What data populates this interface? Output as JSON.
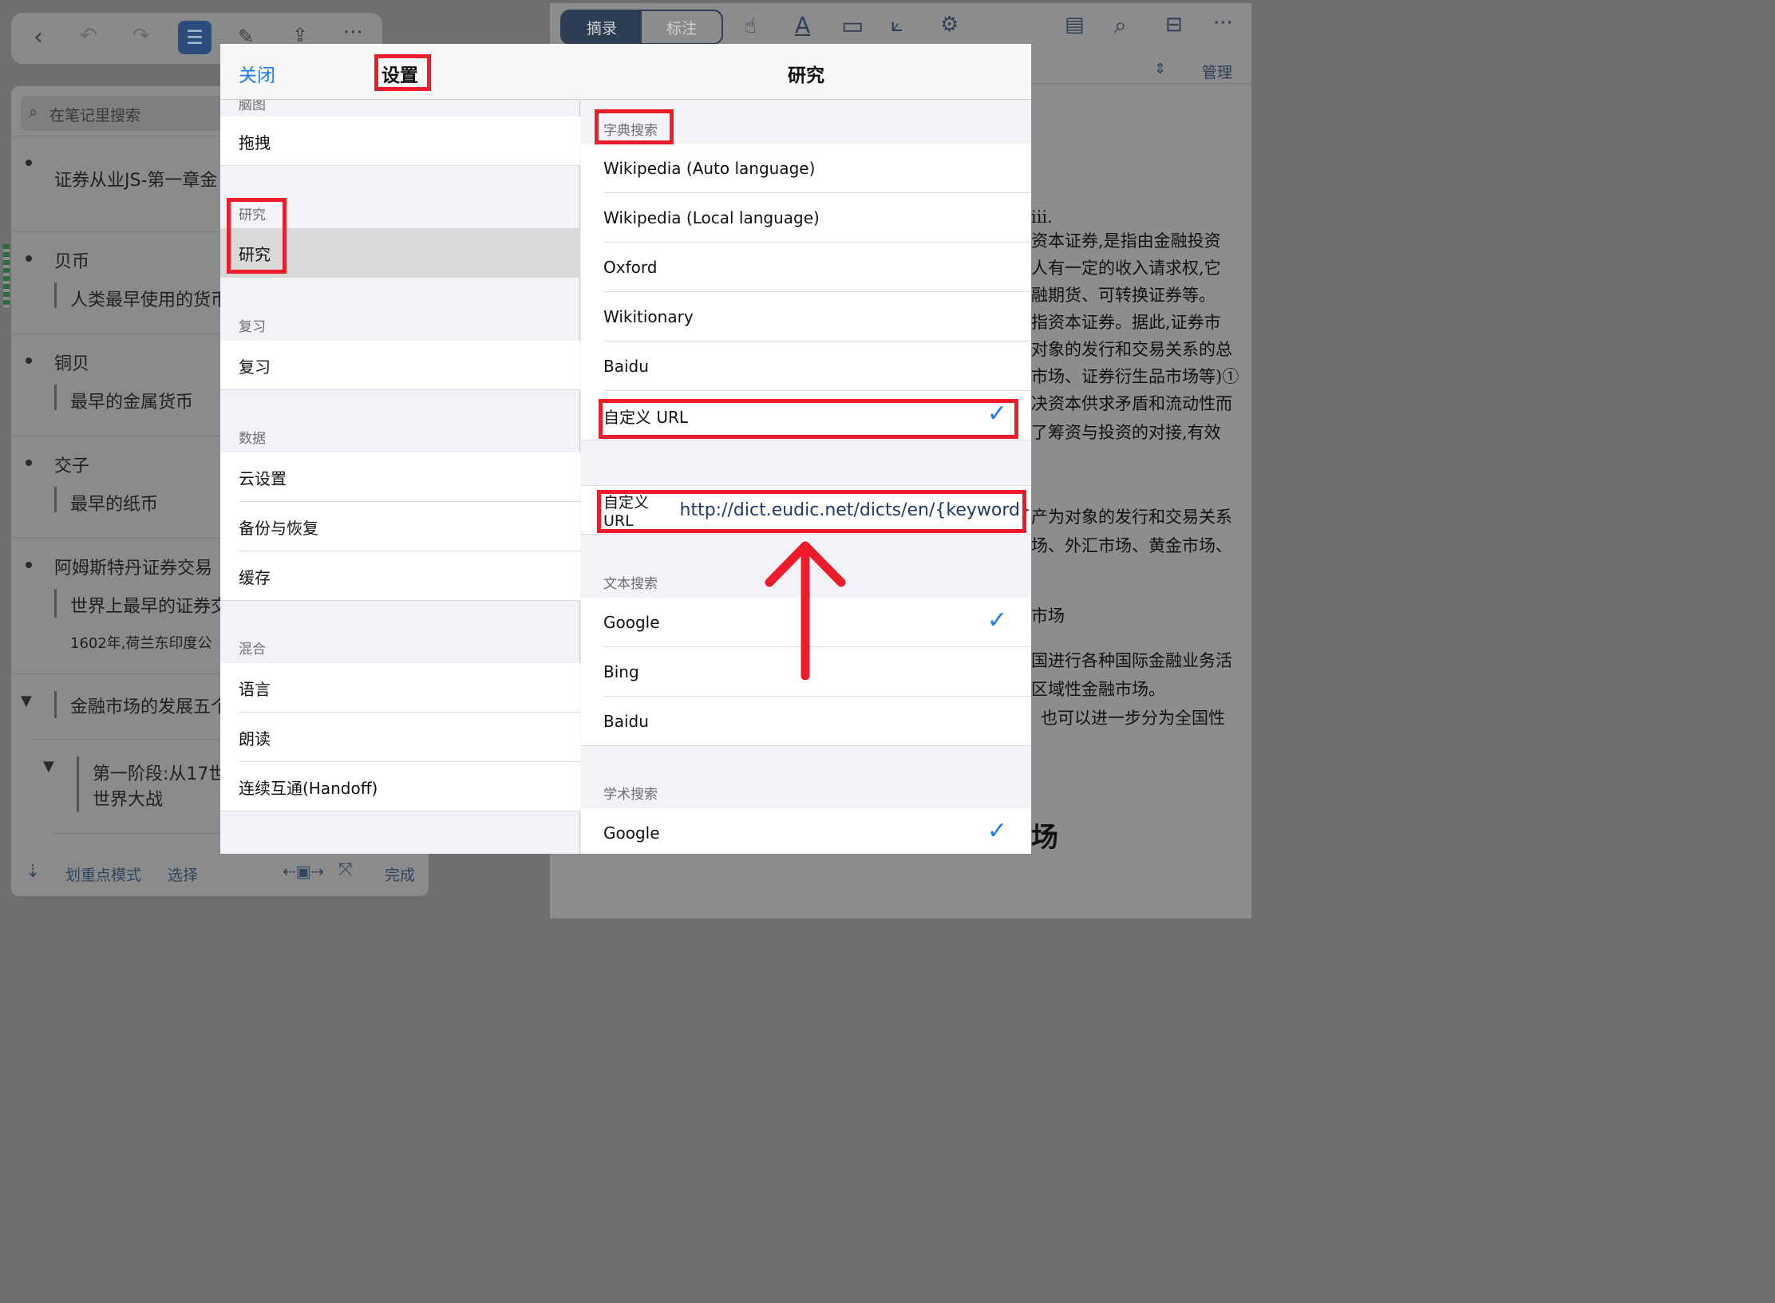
{
  "background": {
    "notes": {
      "search_placeholder": "在笔记里搜索",
      "items": {
        "n1": "证券从业JS-第一章金",
        "n2": "贝币",
        "n2_sub": "人类最早使用的货币",
        "n3": "铜贝",
        "n3_sub": "最早的金属货币",
        "n4": "交子",
        "n4_sub": "最早的纸币",
        "n5": "阿姆斯特丹证券交易",
        "n5_sub": "世界上最早的证券交",
        "n5_sub2": "1602年,荷兰东印度公",
        "n6": "金融市场的发展五个",
        "n7_line1": "第一阶段:从17世",
        "n7_line2": "世界大战"
      },
      "bottom": {
        "highlight_mode": "划重点模式",
        "select": "选择",
        "done": "完成"
      }
    },
    "reader": {
      "segment": {
        "excerpt": "摘录",
        "annotate": "标注"
      },
      "manage": "管理",
      "doc_lines": {
        "l1": "iii.",
        "l2": "资本证券,是指由金融投资",
        "l3": "人有一定的收入请求权,它",
        "l4": "融期货、可转换证券等。",
        "l5": "指资本证券。据此,证券市",
        "l6": "对象的发行和交易关系的总",
        "l7": "市场、证券衍生品市场等)①",
        "l8": "决资本供求矛盾和流动性而",
        "l9": "了筹资与投资的对接,有效",
        "l10": "产为对象的发行和交易关系",
        "l11": "场、外汇市场、黄金市场、",
        "l12": "市场",
        "l13": "国进行各种国际金融业务活",
        "l14": "区域性金融市场。",
        "l15": "也可以进一步分为全国性",
        "l16": "场"
      }
    }
  },
  "settings": {
    "close": "关闭",
    "title": "设置",
    "cut_section": "脑图",
    "drag": "拖拽",
    "research_section": "研究",
    "research_item": "研究",
    "review_section": "复习",
    "review_item": "复习",
    "data_section": "数据",
    "cloud": "云设置",
    "backup": "备份与恢复",
    "cache": "缓存",
    "mixed_section": "混合",
    "language": "语言",
    "read_aloud": "朗读",
    "handoff": "连续互通(Handoff)"
  },
  "research": {
    "title": "研究",
    "dict_section": "字典搜索",
    "dict_items": {
      "wiki_auto": "Wikipedia (Auto language)",
      "wiki_local": "Wikipedia (Local language)",
      "oxford": "Oxford",
      "wiktionary": "Wikitionary",
      "baidu": "Baidu",
      "custom": "自定义 URL"
    },
    "custom_url_label": "自定义 URL",
    "custom_url_value": "http://dict.eudic.net/dicts/en/{keyword}",
    "text_section": "文本搜索",
    "text_items": {
      "google": "Google",
      "bing": "Bing",
      "baidu": "Baidu"
    },
    "academic_section": "学术搜索",
    "academic_items": {
      "google": "Google"
    },
    "checkmark": "✓"
  },
  "colors": {
    "accent": "#1a7cf6",
    "annotation_red": "#ec1c2a"
  }
}
